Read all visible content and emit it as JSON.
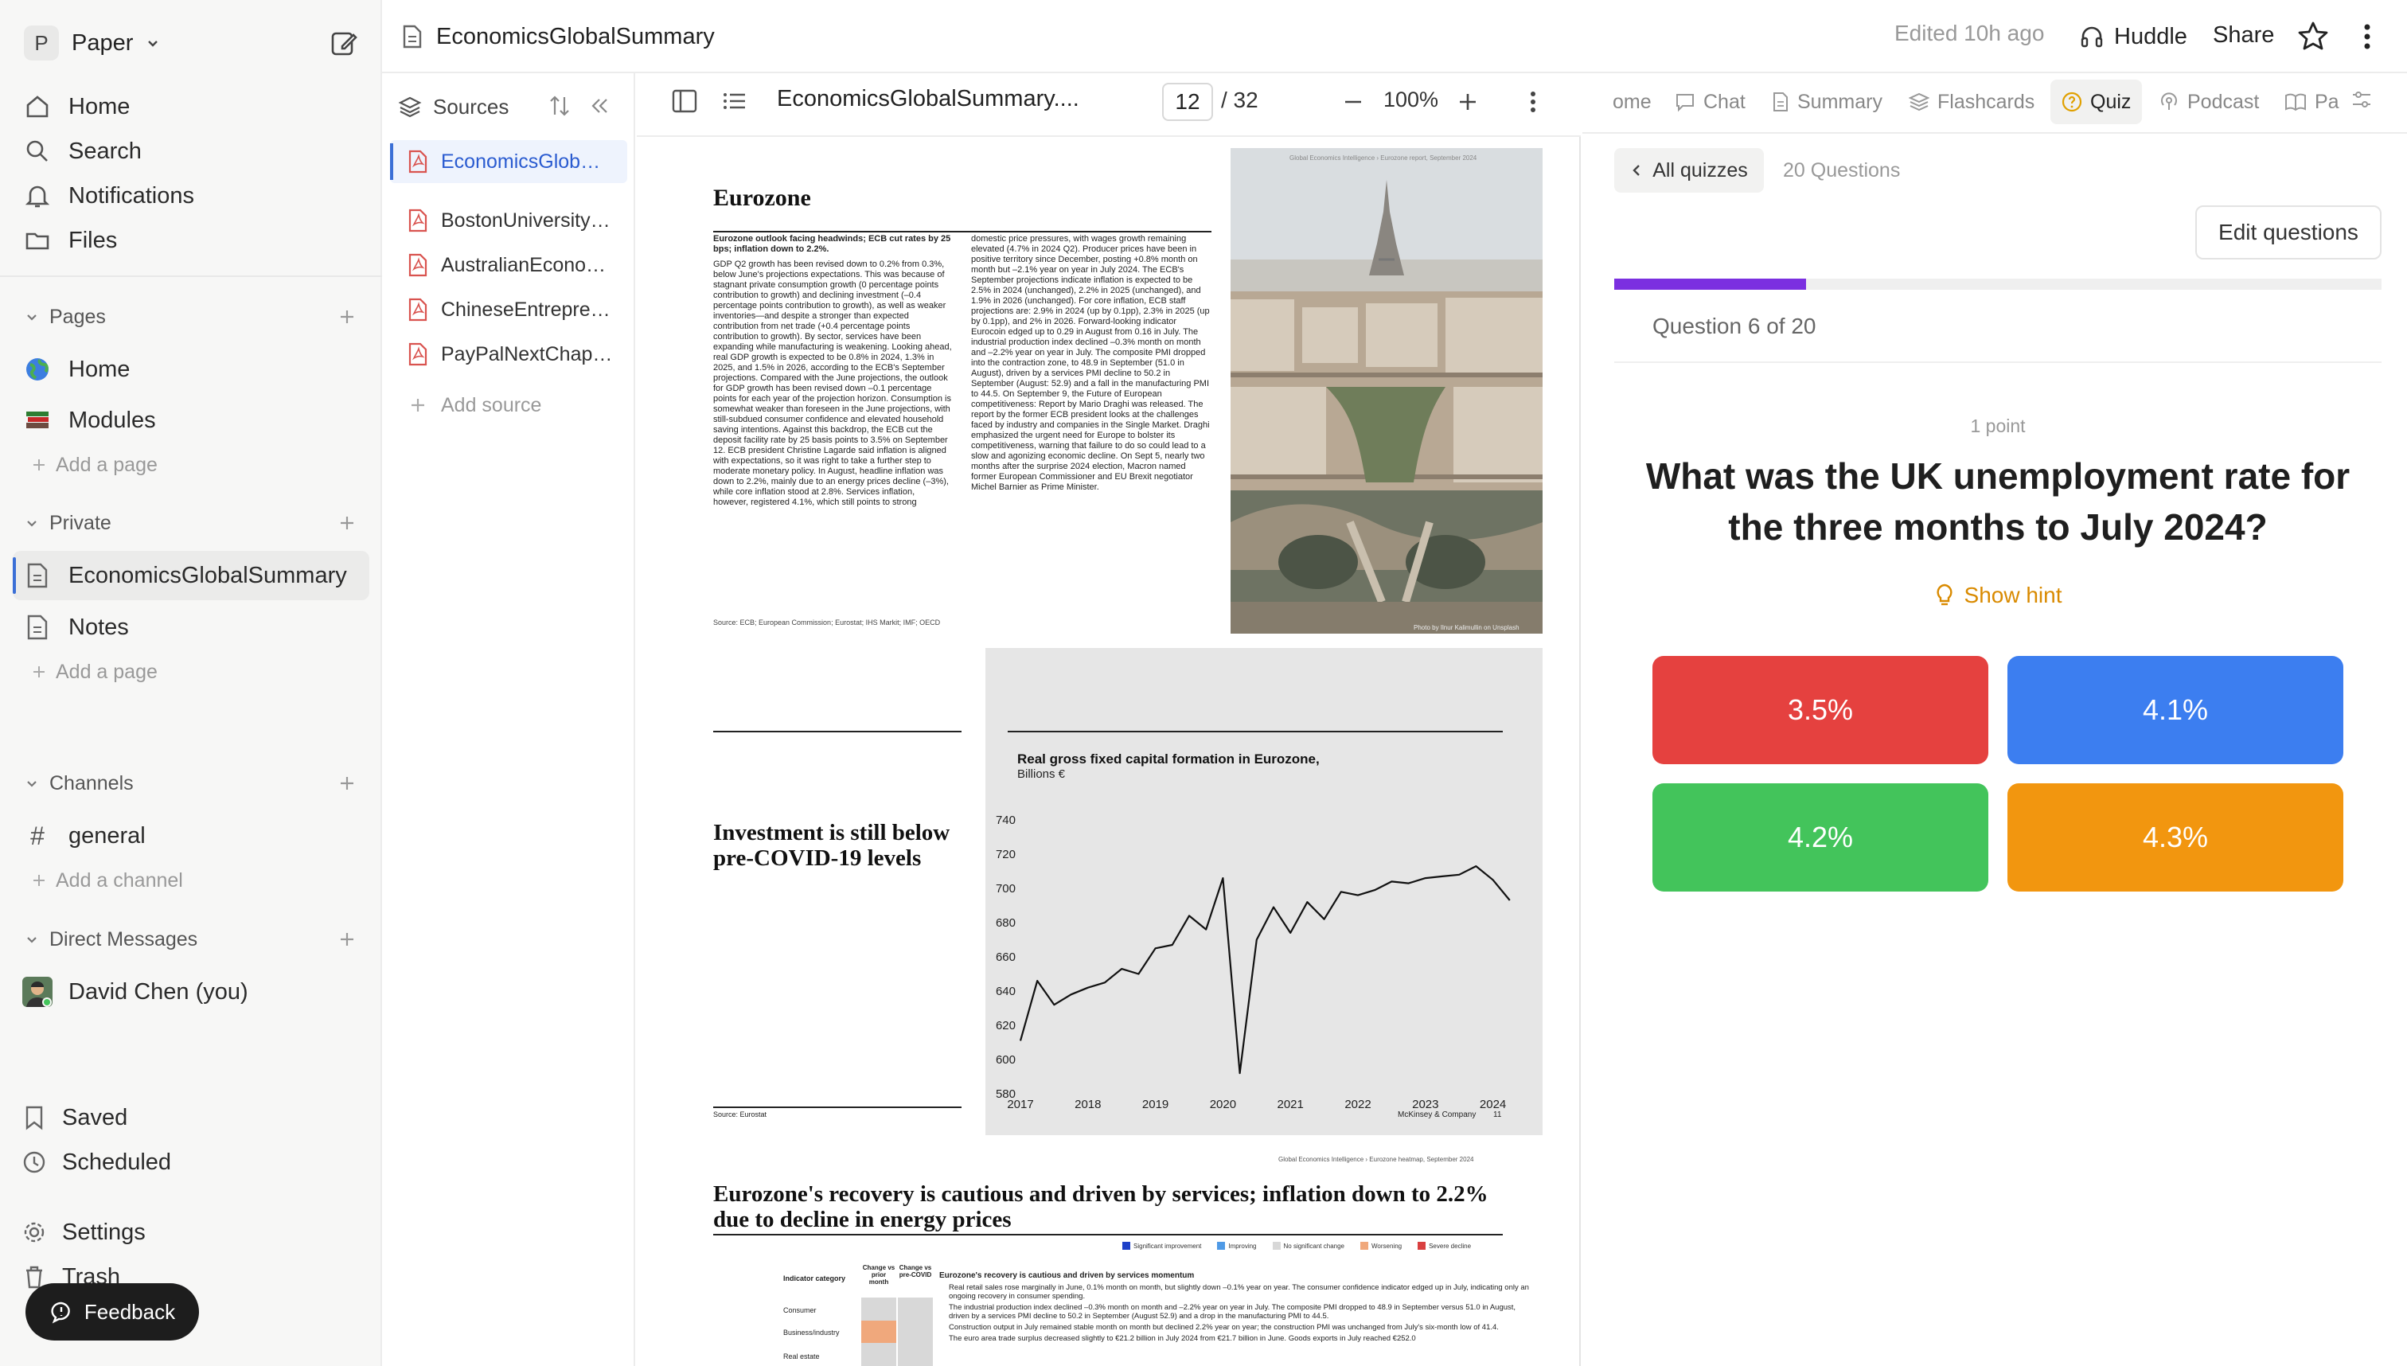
{
  "workspace": {
    "badge": "P",
    "name": "Paper"
  },
  "nav": {
    "home": "Home",
    "search": "Search",
    "notifications": "Notifications",
    "files": "Files"
  },
  "pages_section": {
    "title": "Pages",
    "items": [
      "Home",
      "Modules"
    ],
    "add": "Add a page"
  },
  "private_section": {
    "title": "Private",
    "items": [
      "EconomicsGlobalSummary",
      "Notes"
    ],
    "add": "Add a page"
  },
  "channels_section": {
    "title": "Channels",
    "items": [
      "general"
    ],
    "add": "Add a channel"
  },
  "dm_section": {
    "title": "Direct Messages",
    "items": [
      "David Chen (you)"
    ]
  },
  "bottom_nav": {
    "saved": "Saved",
    "scheduled": "Scheduled",
    "settings": "Settings",
    "trash": "Trash"
  },
  "feedback": "Feedback",
  "topbar": {
    "doc_title": "EconomicsGlobalSummary",
    "edited": "Edited 10h ago",
    "huddle": "Huddle",
    "share": "Share"
  },
  "sources": {
    "title": "Sources",
    "items": [
      "EconomicsGlob…",
      "BostonUniversity…",
      "AustralianEcono…",
      "ChineseEntrepre…",
      "PayPalNextChap…"
    ],
    "add": "Add source"
  },
  "viewer": {
    "file_name": "EconomicsGlobalSummary....",
    "page": "12",
    "total": "/ 32",
    "zoom": "100%"
  },
  "pdf": {
    "header_tag": "Global Economics Intelligence › Eurozone report, September 2024",
    "section_title": "Eurozone",
    "lead": "Eurozone outlook facing headwinds; ECB cut rates by 25 bps; inflation down to 2.2%.",
    "col1": "GDP Q2 growth has been revised down to 0.2% from 0.3%, below June's projections expectations. This was because of stagnant private consumption growth (0 percentage points contribution to growth) and declining investment (–0.4 percentage points contribution to growth), as well as weaker inventories—and despite a stronger than expected contribution from net trade (+0.4 percentage points contribution to growth). By sector, services have been expanding while manufacturing is weakening. Looking ahead, real GDP growth is expected to be 0.8% in 2024, 1.3% in 2025, and 1.5% in 2026, according to the ECB's September projections. Compared with the June projections, the outlook for GDP growth has been revised down –0.1 percentage points for each year of the projection horizon. Consumption is somewhat weaker than foreseen in the June projections, with still-subdued consumer confidence and elevated household saving intentions. Against this backdrop, the ECB cut the deposit facility rate by 25 basis points to 3.5% on September 12. ECB president Christine Lagarde said inflation is aligned with expectations, so it was right to take a further step to moderate monetary policy. In August, headline inflation was down to 2.2%, mainly due to an energy prices decline (–3%), while core inflation stood at 2.8%. Services inflation, however, registered 4.1%, which still points to strong",
    "col2": "domestic price pressures, with wages growth remaining elevated (4.7% in 2024 Q2). Producer prices have been in positive territory since December, posting +0.8% month on month but –2.1% year on year in July 2024. The ECB's September projections indicate inflation is expected to be 2.5% in 2024 (unchanged), 2.2% in 2025 (unchanged), and 1.9% in 2026 (unchanged). For core inflation, ECB staff projections are: 2.9% in 2024 (up by 0.1pp), 2.3% in 2025 (up by 0.1pp), and 2% in 2026. Forward-looking indicator Eurocoin edged up to 0.29 in August from 0.16 in July. The industrial production index declined –0.3% month on month and –2.2% year on year in July. The composite PMI dropped into the contraction zone, to 48.9 in September (51.0 in August), driven by a services PMI decline to 50.2 in September (August: 52.9) and a fall in the manufacturing PMI to 44.5. On September 9, the Future of European competitiveness: Report by Mario Draghi was released. The report by the former ECB president looks at the challenges faced by industry and companies in the Single Market. Draghi emphasized the urgent need for Europe to bolster its competitiveness, warning that failure to do so could lead to a slow and agonizing economic decline. On Sept 5, nearly two months after the surprise 2024 election, Macron named former European Commissioner and EU Brexit negotiator Michel Barnier as Prime Minister.",
    "source1": "Source: ECB; European Commission; Eurostat; IHS Markit; IMF; OECD",
    "photo_credit": "Photo by Ilnur Kalimullin on Unsplash",
    "invest_title": "Investment is still below pre-COVID-19 levels",
    "source2": "Source: Eurostat",
    "footer": "McKinsey & Company",
    "page_no": "11",
    "header_tag2": "Global Economics Intelligence › Eurozone heatmap, September 2024",
    "recovery_title": "Eurozone's recovery is cautious and driven by services; inflation down to 2.2% due to decline in energy prices",
    "legend": [
      "Significant improvement",
      "Improving",
      "No significant change",
      "Worsening",
      "Severe decline"
    ],
    "table_headers": [
      "Indicator category",
      "Change vs prior month",
      "Change vs pre-COVID",
      "Eurozone's recovery is cautious and driven by services momentum"
    ],
    "table_rows": [
      "Consumer",
      "Business/industry",
      "Real estate"
    ],
    "bullets": [
      "Real retail sales rose marginally in June, 0.1% month on month, but slightly down –0.1% year on year. The consumer confidence indicator edged up in July, indicating only an ongoing recovery in consumer spending.",
      "The industrial production index declined –0.3% month on month and –2.2% year on year in July. The composite PMI dropped to 48.9 in September versus 51.0 in August, driven by a services PMI decline to 50.2 in September (August 52.9) and a drop in the manufacturing PMI to 44.5.",
      "Construction output in July remained stable month on month but declined 2.2% year on year; the construction PMI was unchanged from July's six-month low of 41.4.",
      "The euro area trade surplus decreased slightly to €21.2 billion in July 2024 from €21.7 billion in June. Goods exports in July reached €252.0"
    ]
  },
  "chart_data": {
    "type": "line",
    "title": "Real gross fixed capital formation in Eurozone,",
    "subtitle": "Billions €",
    "xlabel": "",
    "ylabel": "",
    "x_ticks": [
      "2017",
      "2018",
      "2019",
      "2020",
      "2021",
      "2022",
      "2023",
      "2024"
    ],
    "y_ticks": [
      580,
      600,
      620,
      640,
      660,
      680,
      700,
      720,
      740
    ],
    "xlim": [
      2017.0,
      2024.5
    ],
    "ylim": [
      580,
      740
    ],
    "grid": false,
    "series": [
      {
        "values": [
          [
            2017.0,
            611
          ],
          [
            2017.25,
            646
          ],
          [
            2017.5,
            632
          ],
          [
            2017.75,
            638
          ],
          [
            2018.0,
            642
          ],
          [
            2018.25,
            645
          ],
          [
            2018.5,
            653
          ],
          [
            2018.75,
            650
          ],
          [
            2019.0,
            665
          ],
          [
            2019.25,
            667
          ],
          [
            2019.5,
            684
          ],
          [
            2019.75,
            676
          ],
          [
            2020.0,
            706
          ],
          [
            2020.25,
            592
          ],
          [
            2020.5,
            670
          ],
          [
            2020.75,
            689
          ],
          [
            2021.0,
            674
          ],
          [
            2021.25,
            692
          ],
          [
            2021.5,
            682
          ],
          [
            2021.75,
            698
          ],
          [
            2022.0,
            696
          ],
          [
            2022.25,
            699
          ],
          [
            2022.5,
            704
          ],
          [
            2022.75,
            703
          ],
          [
            2023.0,
            706
          ],
          [
            2023.25,
            707
          ],
          [
            2023.5,
            708
          ],
          [
            2023.75,
            713
          ],
          [
            2024.0,
            705
          ],
          [
            2024.25,
            693
          ]
        ]
      }
    ]
  },
  "tabs": [
    "ome",
    "Chat",
    "Summary",
    "Flashcards",
    "Quiz",
    "Podcast",
    "Pa"
  ],
  "quiz": {
    "back_label": "All quizzes",
    "count": "20 Questions",
    "edit": "Edit questions",
    "progress": 0.25,
    "progress_label": "Question 6 of 20",
    "points": "1 point",
    "question": "What was the UK unemployment rate for the three months to July 2024?",
    "hint": "Show hint",
    "answers": [
      {
        "label": "3.5%",
        "color": "#e5413f"
      },
      {
        "label": "4.1%",
        "color": "#3c7ef0"
      },
      {
        "label": "4.2%",
        "color": "#43c45b"
      },
      {
        "label": "4.3%",
        "color": "#f2960f"
      }
    ],
    "accent": "#7b2fe0"
  }
}
